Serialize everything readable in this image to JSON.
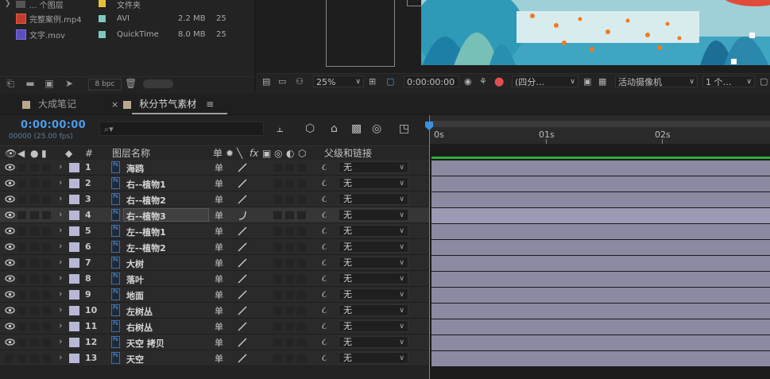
{
  "project": {
    "files": [
      {
        "name": "... 个图层",
        "type": "文件夹",
        "size": "",
        "count": "",
        "label_color": "#e3c23a"
      },
      {
        "name": "完整案例.mp4",
        "type": "AVI",
        "size": "2.2 MB",
        "count": "25",
        "label_color": "#7dc9c0"
      },
      {
        "name": "文字.mov",
        "type": "QuickTime",
        "size": "8.0 MB",
        "count": "25",
        "label_color": "#7dc9c0"
      }
    ],
    "bpc_label": "8 bpc"
  },
  "viewer": {
    "zoom": "25%",
    "timecode": "0:00:00:00",
    "resolution": "(四分…",
    "camera": "活动摄像机",
    "views": "1 个…"
  },
  "timeline": {
    "tabs": [
      {
        "label": "大成笔记",
        "active": false
      },
      {
        "label": "秋分节气素材",
        "active": true
      }
    ],
    "current_time": "0:00:00:00",
    "fps_label": "00000 (25.00 fps)",
    "search_placeholder": "",
    "columns": {
      "layer_name": "图层名称",
      "num": "#",
      "parent_link": "父级和链接"
    },
    "ruler_labels": [
      "0s",
      "01s",
      "02s"
    ],
    "layers": [
      {
        "num": "1",
        "name": "海鸥",
        "parent": "无",
        "selected": false
      },
      {
        "num": "2",
        "name": "右--植物1",
        "parent": "无",
        "selected": false
      },
      {
        "num": "3",
        "name": "右--植物2",
        "parent": "无",
        "selected": false
      },
      {
        "num": "4",
        "name": "右--植物3",
        "parent": "无",
        "selected": true
      },
      {
        "num": "5",
        "name": "左--植物1",
        "parent": "无",
        "selected": false
      },
      {
        "num": "6",
        "name": "左--植物2",
        "parent": "无",
        "selected": false
      },
      {
        "num": "7",
        "name": "大树",
        "parent": "无",
        "selected": false
      },
      {
        "num": "8",
        "name": "落叶",
        "parent": "无",
        "selected": false
      },
      {
        "num": "9",
        "name": "地面",
        "parent": "无",
        "selected": false
      },
      {
        "num": "10",
        "name": "左树丛",
        "parent": "无",
        "selected": false
      },
      {
        "num": "11",
        "name": "右树丛",
        "parent": "无",
        "selected": false
      },
      {
        "num": "12",
        "name": "天空 拷贝",
        "parent": "无",
        "selected": false
      },
      {
        "num": "13",
        "name": "天空",
        "parent": "无",
        "selected": false
      }
    ]
  },
  "colors": {
    "timecode": "#4b9cea",
    "layer_label": "#b8b8d6",
    "bar": "#8b8aa2",
    "work_area": "#2fae3c"
  }
}
